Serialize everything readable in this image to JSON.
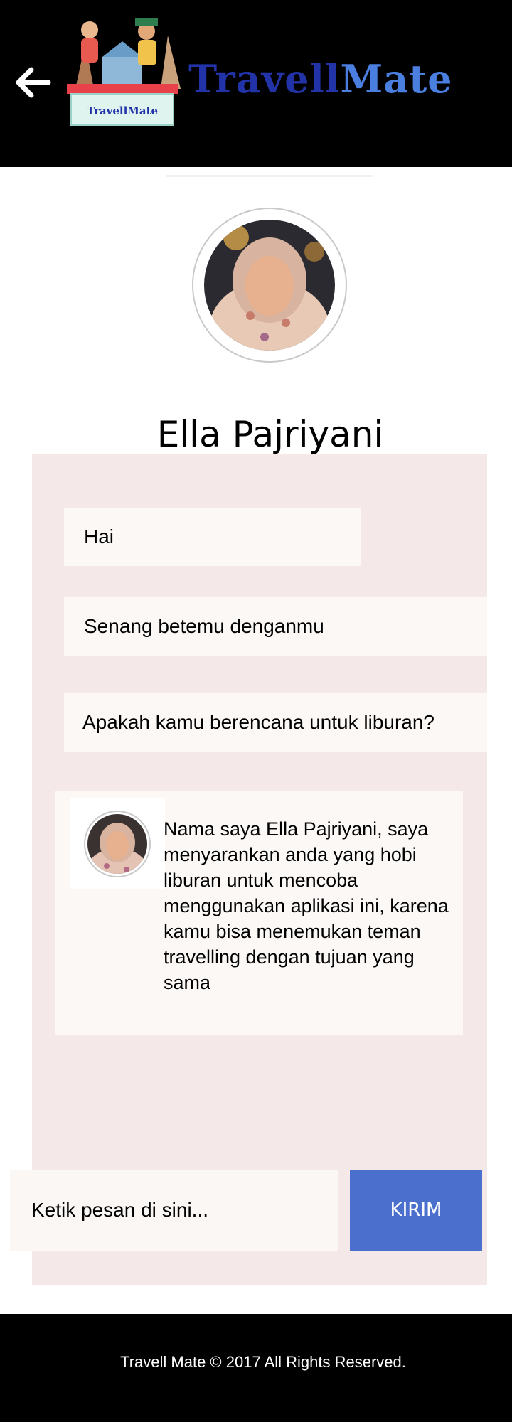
{
  "header": {
    "brand_part1": "Travell",
    "brand_part2": "Mate",
    "logo_text": "TravellMate",
    "back_icon": "arrow-left-icon"
  },
  "profile": {
    "name": "Ella Pajriyani"
  },
  "messages": [
    {
      "text": "Hai"
    },
    {
      "text": "Senang betemu denganmu"
    },
    {
      "text": "Apakah kamu berencana untuk liburan?"
    }
  ],
  "reply": {
    "text": "Nama saya Ella Pajriyani, saya menyarankan anda yang hobi liburan untuk mencoba menggunakan aplikasi ini, karena kamu bisa menemukan teman travelling dengan tujuan yang sama"
  },
  "composer": {
    "placeholder": "Ketik pesan di sini...",
    "send_label": "KIRIM"
  },
  "footer": {
    "copyright": "Travell Mate © 2017 All Rights Reserved."
  },
  "colors": {
    "header_bg": "#000000",
    "brand_dark": "#2233a8",
    "brand_light": "#4a7fe0",
    "chat_bg": "#f4e8e8",
    "bubble_bg": "#fbf8f6",
    "send_button": "#4a6fcc"
  }
}
